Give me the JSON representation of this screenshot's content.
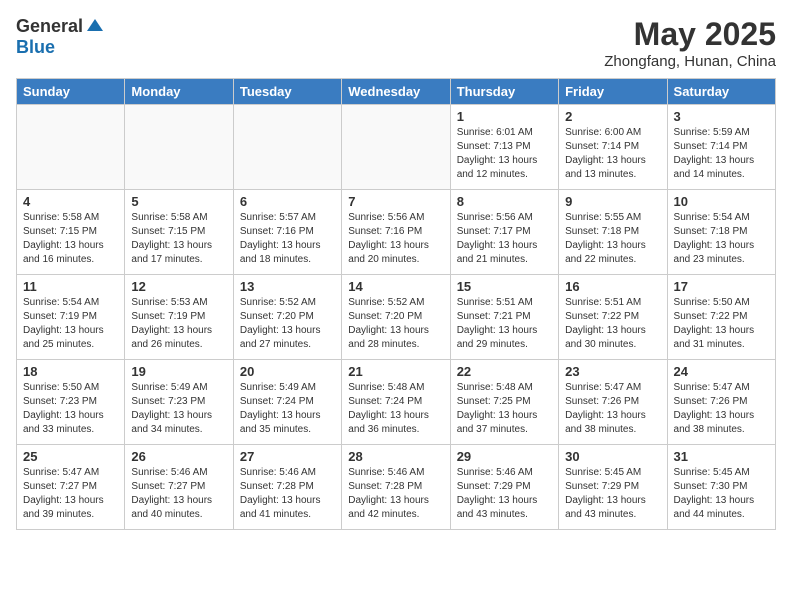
{
  "header": {
    "logo_general": "General",
    "logo_blue": "Blue",
    "title": "May 2025",
    "location": "Zhongfang, Hunan, China"
  },
  "weekdays": [
    "Sunday",
    "Monday",
    "Tuesday",
    "Wednesday",
    "Thursday",
    "Friday",
    "Saturday"
  ],
  "weeks": [
    [
      {
        "day": "",
        "info": ""
      },
      {
        "day": "",
        "info": ""
      },
      {
        "day": "",
        "info": ""
      },
      {
        "day": "",
        "info": ""
      },
      {
        "day": "1",
        "info": "Sunrise: 6:01 AM\nSunset: 7:13 PM\nDaylight: 13 hours\nand 12 minutes."
      },
      {
        "day": "2",
        "info": "Sunrise: 6:00 AM\nSunset: 7:14 PM\nDaylight: 13 hours\nand 13 minutes."
      },
      {
        "day": "3",
        "info": "Sunrise: 5:59 AM\nSunset: 7:14 PM\nDaylight: 13 hours\nand 14 minutes."
      }
    ],
    [
      {
        "day": "4",
        "info": "Sunrise: 5:58 AM\nSunset: 7:15 PM\nDaylight: 13 hours\nand 16 minutes."
      },
      {
        "day": "5",
        "info": "Sunrise: 5:58 AM\nSunset: 7:15 PM\nDaylight: 13 hours\nand 17 minutes."
      },
      {
        "day": "6",
        "info": "Sunrise: 5:57 AM\nSunset: 7:16 PM\nDaylight: 13 hours\nand 18 minutes."
      },
      {
        "day": "7",
        "info": "Sunrise: 5:56 AM\nSunset: 7:16 PM\nDaylight: 13 hours\nand 20 minutes."
      },
      {
        "day": "8",
        "info": "Sunrise: 5:56 AM\nSunset: 7:17 PM\nDaylight: 13 hours\nand 21 minutes."
      },
      {
        "day": "9",
        "info": "Sunrise: 5:55 AM\nSunset: 7:18 PM\nDaylight: 13 hours\nand 22 minutes."
      },
      {
        "day": "10",
        "info": "Sunrise: 5:54 AM\nSunset: 7:18 PM\nDaylight: 13 hours\nand 23 minutes."
      }
    ],
    [
      {
        "day": "11",
        "info": "Sunrise: 5:54 AM\nSunset: 7:19 PM\nDaylight: 13 hours\nand 25 minutes."
      },
      {
        "day": "12",
        "info": "Sunrise: 5:53 AM\nSunset: 7:19 PM\nDaylight: 13 hours\nand 26 minutes."
      },
      {
        "day": "13",
        "info": "Sunrise: 5:52 AM\nSunset: 7:20 PM\nDaylight: 13 hours\nand 27 minutes."
      },
      {
        "day": "14",
        "info": "Sunrise: 5:52 AM\nSunset: 7:20 PM\nDaylight: 13 hours\nand 28 minutes."
      },
      {
        "day": "15",
        "info": "Sunrise: 5:51 AM\nSunset: 7:21 PM\nDaylight: 13 hours\nand 29 minutes."
      },
      {
        "day": "16",
        "info": "Sunrise: 5:51 AM\nSunset: 7:22 PM\nDaylight: 13 hours\nand 30 minutes."
      },
      {
        "day": "17",
        "info": "Sunrise: 5:50 AM\nSunset: 7:22 PM\nDaylight: 13 hours\nand 31 minutes."
      }
    ],
    [
      {
        "day": "18",
        "info": "Sunrise: 5:50 AM\nSunset: 7:23 PM\nDaylight: 13 hours\nand 33 minutes."
      },
      {
        "day": "19",
        "info": "Sunrise: 5:49 AM\nSunset: 7:23 PM\nDaylight: 13 hours\nand 34 minutes."
      },
      {
        "day": "20",
        "info": "Sunrise: 5:49 AM\nSunset: 7:24 PM\nDaylight: 13 hours\nand 35 minutes."
      },
      {
        "day": "21",
        "info": "Sunrise: 5:48 AM\nSunset: 7:24 PM\nDaylight: 13 hours\nand 36 minutes."
      },
      {
        "day": "22",
        "info": "Sunrise: 5:48 AM\nSunset: 7:25 PM\nDaylight: 13 hours\nand 37 minutes."
      },
      {
        "day": "23",
        "info": "Sunrise: 5:47 AM\nSunset: 7:26 PM\nDaylight: 13 hours\nand 38 minutes."
      },
      {
        "day": "24",
        "info": "Sunrise: 5:47 AM\nSunset: 7:26 PM\nDaylight: 13 hours\nand 38 minutes."
      }
    ],
    [
      {
        "day": "25",
        "info": "Sunrise: 5:47 AM\nSunset: 7:27 PM\nDaylight: 13 hours\nand 39 minutes."
      },
      {
        "day": "26",
        "info": "Sunrise: 5:46 AM\nSunset: 7:27 PM\nDaylight: 13 hours\nand 40 minutes."
      },
      {
        "day": "27",
        "info": "Sunrise: 5:46 AM\nSunset: 7:28 PM\nDaylight: 13 hours\nand 41 minutes."
      },
      {
        "day": "28",
        "info": "Sunrise: 5:46 AM\nSunset: 7:28 PM\nDaylight: 13 hours\nand 42 minutes."
      },
      {
        "day": "29",
        "info": "Sunrise: 5:46 AM\nSunset: 7:29 PM\nDaylight: 13 hours\nand 43 minutes."
      },
      {
        "day": "30",
        "info": "Sunrise: 5:45 AM\nSunset: 7:29 PM\nDaylight: 13 hours\nand 43 minutes."
      },
      {
        "day": "31",
        "info": "Sunrise: 5:45 AM\nSunset: 7:30 PM\nDaylight: 13 hours\nand 44 minutes."
      }
    ]
  ]
}
